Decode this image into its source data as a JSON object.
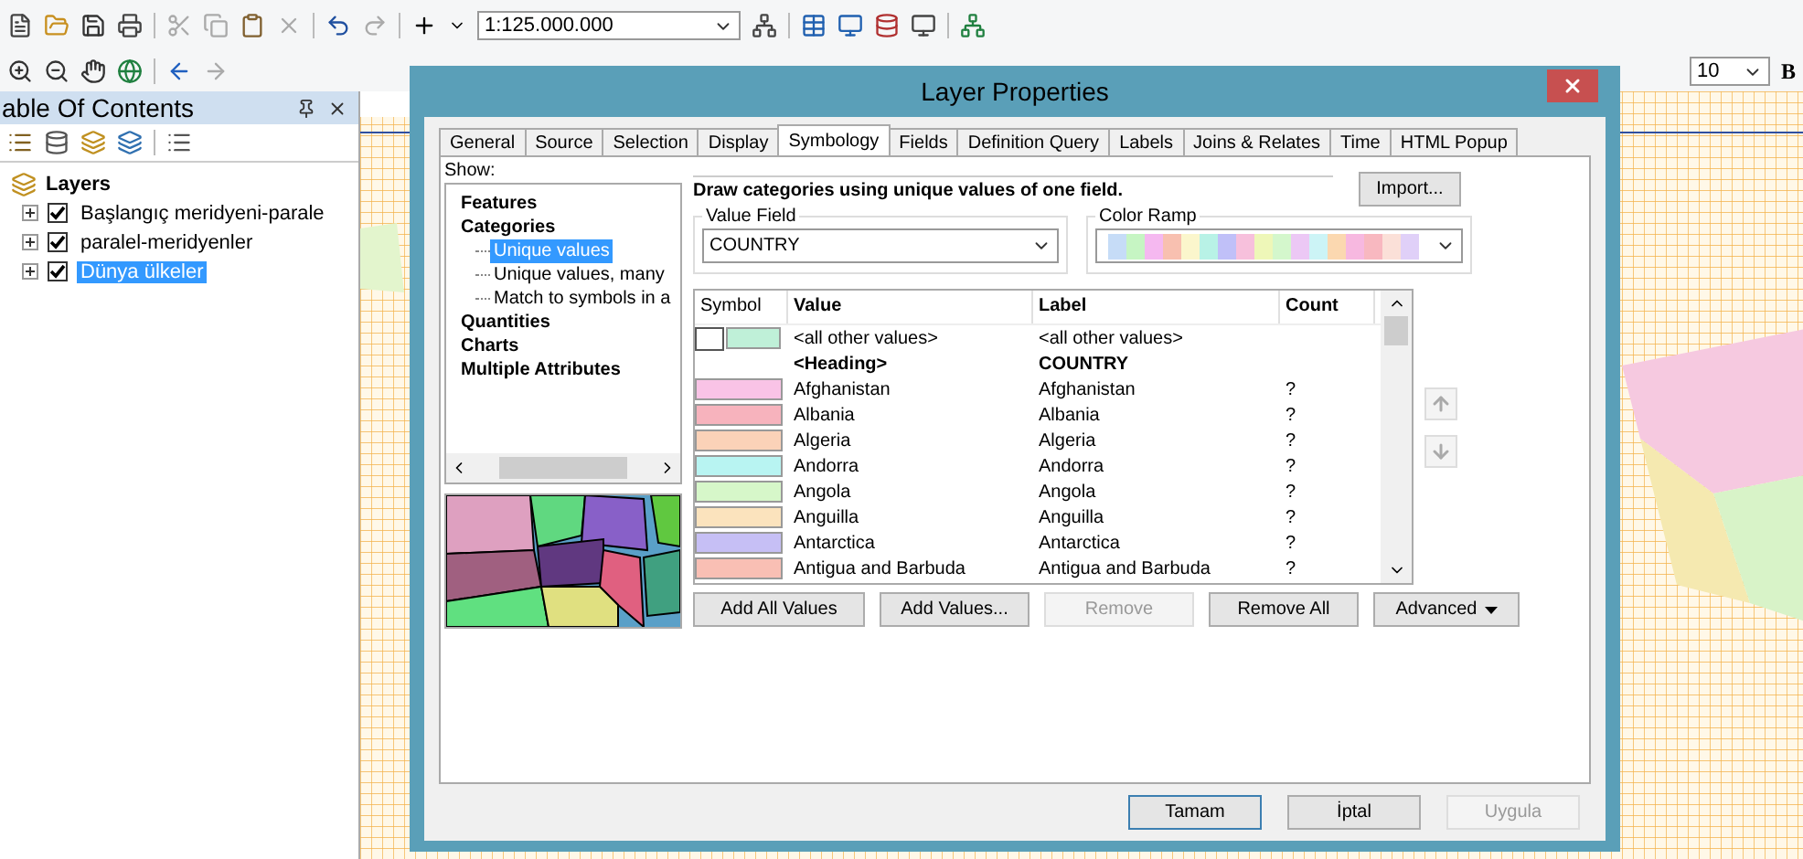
{
  "toolbar": {
    "scale": "1:125.000.000",
    "font_size": "10",
    "bold_button": "B"
  },
  "toc": {
    "title": "able Of Contents",
    "root": "Layers",
    "layers": [
      {
        "name": "Başlangıç meridyeni-parale",
        "checked": true,
        "expanded": false,
        "selected": false
      },
      {
        "name": "paralel-meridyenler",
        "checked": true,
        "expanded": false,
        "selected": false
      },
      {
        "name": "Dünya ülkeler",
        "checked": true,
        "expanded": false,
        "selected": true
      }
    ]
  },
  "dialog": {
    "title": "Layer Properties",
    "tabs": [
      {
        "label": "General",
        "selected": false
      },
      {
        "label": "Source",
        "selected": false
      },
      {
        "label": "Selection",
        "selected": false
      },
      {
        "label": "Display",
        "selected": false
      },
      {
        "label": "Symbology",
        "selected": true
      },
      {
        "label": "Fields",
        "selected": false
      },
      {
        "label": "Definition Query",
        "selected": false
      },
      {
        "label": "Labels",
        "selected": false
      },
      {
        "label": "Joins & Relates",
        "selected": false
      },
      {
        "label": "Time",
        "selected": false
      },
      {
        "label": "HTML Popup",
        "selected": false
      }
    ],
    "show_label": "Show:",
    "show_tree": [
      {
        "label": "Features",
        "selected": false
      },
      {
        "label": "Categories",
        "selected": false,
        "children": [
          {
            "label": "Unique values",
            "selected": true
          },
          {
            "label": "Unique values, many",
            "selected": false
          },
          {
            "label": "Match to symbols in a",
            "selected": false
          }
        ]
      },
      {
        "label": "Quantities",
        "selected": false
      },
      {
        "label": "Charts",
        "selected": false
      },
      {
        "label": "Multiple Attributes",
        "selected": false
      }
    ],
    "description": "Draw categories using unique values of one field.",
    "import_button": "Import...",
    "value_field": {
      "legend": "Value Field",
      "value": "COUNTRY"
    },
    "color_ramp": {
      "legend": "Color Ramp"
    },
    "table": {
      "columns": [
        "Symbol",
        "Value",
        "Label",
        "Count"
      ],
      "rows": [
        {
          "kind": "other",
          "color": "#bff0d8",
          "value": "<all other values>",
          "label": "<all other values>"
        },
        {
          "kind": "heading",
          "value": "<Heading>",
          "label": "COUNTRY"
        },
        {
          "kind": "value",
          "color": "#f9c3e6",
          "value": "Afghanistan",
          "label": "Afghanistan",
          "count": "?"
        },
        {
          "kind": "value",
          "color": "#f7b3bd",
          "value": "Albania",
          "label": "Albania",
          "count": "?"
        },
        {
          "kind": "value",
          "color": "#fbd2b8",
          "value": "Algeria",
          "label": "Algeria",
          "count": "?"
        },
        {
          "kind": "value",
          "color": "#b8f4f2",
          "value": "Andorra",
          "label": "Andorra",
          "count": "?"
        },
        {
          "kind": "value",
          "color": "#d6f7c9",
          "value": "Angola",
          "label": "Angola",
          "count": "?"
        },
        {
          "kind": "value",
          "color": "#fbe3bd",
          "value": "Anguilla",
          "label": "Anguilla",
          "count": "?"
        },
        {
          "kind": "value",
          "color": "#c6bff5",
          "value": "Antarctica",
          "label": "Antarctica",
          "count": "?"
        },
        {
          "kind": "value",
          "color": "#f9bfb4",
          "value": "Antigua and Barbuda",
          "label": "Antigua and Barbuda",
          "count": "?"
        }
      ]
    },
    "actions": [
      {
        "label": "Add All Values",
        "disabled": false
      },
      {
        "label": "Add Values...",
        "disabled": false
      },
      {
        "label": "Remove",
        "disabled": true
      },
      {
        "label": "Remove All",
        "disabled": false
      },
      {
        "label": "Advanced",
        "disabled": false,
        "menu": true
      }
    ],
    "footer": [
      {
        "label": "Tamam",
        "disabled": false,
        "default": true
      },
      {
        "label": "İptal",
        "disabled": false,
        "default": false
      },
      {
        "label": "Uygula",
        "disabled": true,
        "default": false
      }
    ]
  }
}
